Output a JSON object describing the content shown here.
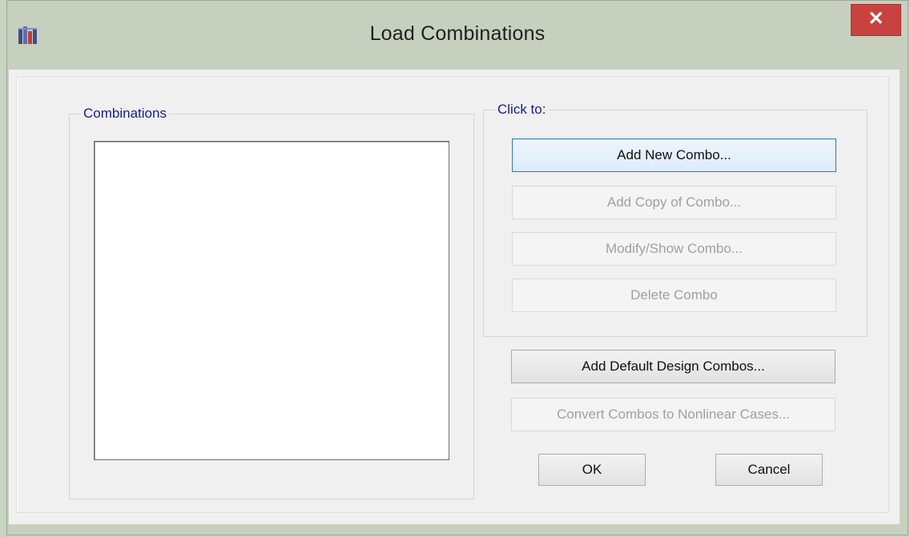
{
  "window": {
    "title": "Load Combinations",
    "close_glyph": "✕",
    "app_icon": "csi-app-icon"
  },
  "combinations_group": {
    "label": "Combinations",
    "items": []
  },
  "click_group": {
    "label": "Click to:",
    "buttons": [
      {
        "label": "Add New Combo...",
        "enabled": true
      },
      {
        "label": "Add Copy of Combo...",
        "enabled": false
      },
      {
        "label": "Modify/Show Combo...",
        "enabled": false
      },
      {
        "label": "Delete Combo",
        "enabled": false
      }
    ]
  },
  "actions": {
    "add_default_label": "Add Default Design Combos...",
    "convert_label": "Convert Combos to Nonlinear Cases...",
    "ok_label": "OK",
    "cancel_label": "Cancel"
  },
  "colors": {
    "close_button": "#c8433f",
    "group_label": "#1b1b8f",
    "focus_border": "#3c7fb1"
  }
}
